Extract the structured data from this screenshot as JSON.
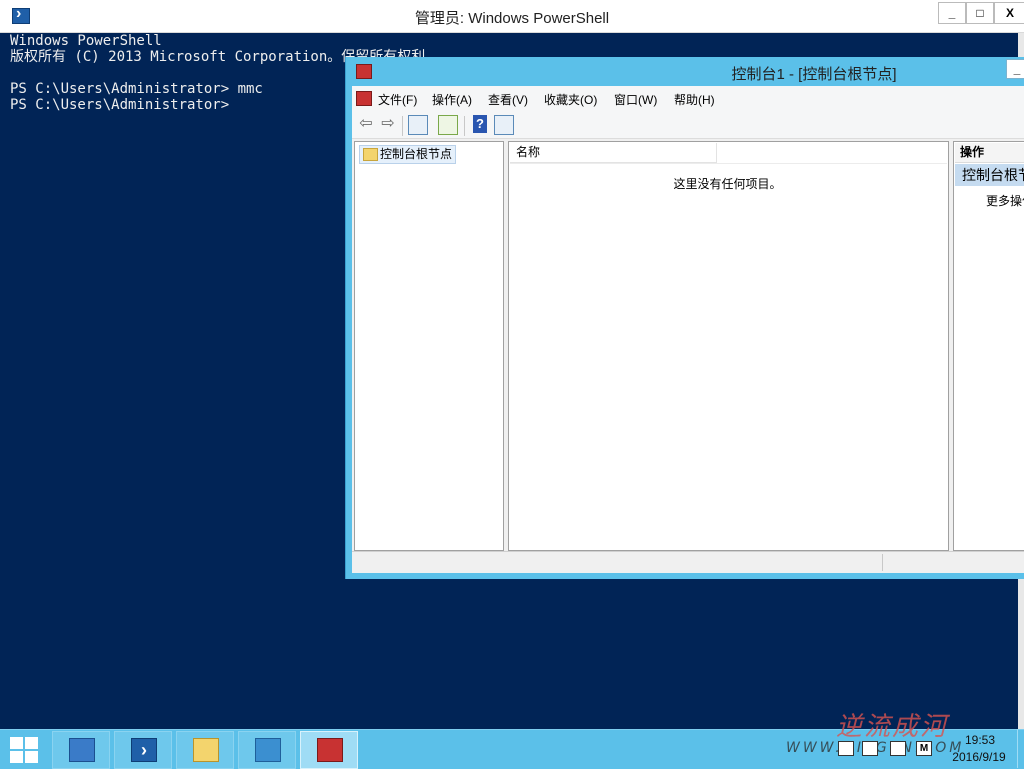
{
  "powershell": {
    "title": "管理员: Windows PowerShell",
    "lines": [
      "Windows PowerShell",
      "版权所有 (C) 2013 Microsoft Corporation。保留所有权利。",
      "",
      "PS C:\\Users\\Administrator> mmc",
      "PS C:\\Users\\Administrator>"
    ],
    "controls": {
      "minimize": "_",
      "maximize": "□",
      "close": "X"
    }
  },
  "mmc": {
    "title": "控制台1 - [控制台根节点]",
    "menu": [
      "文件(F)",
      "操作(A)",
      "查看(V)",
      "收藏夹(O)",
      "窗口(W)",
      "帮助(H)"
    ],
    "toolbar": [
      "back-icon",
      "forward-icon",
      "show-hide-tree-icon",
      "export-list-icon",
      "help-icon",
      "show-hide-action-pane-icon"
    ],
    "tree_root": "控制台根节点",
    "list_header": "名称",
    "empty_message": "这里没有任何项目。",
    "actions": {
      "header": "操作",
      "node": "控制台根节点",
      "more": "更多操作"
    }
  },
  "taskbar": {
    "items": [
      "server-manager-icon",
      "powershell-icon",
      "file-explorer-icon",
      "control-panel-icon",
      "mmc-icon"
    ],
    "time": "19:53",
    "date": "2016/9/19",
    "watermark_title": "逆流成河",
    "watermark_url": "WWW.QIEGEN.COM"
  },
  "colors": {
    "ps_background": "#012456",
    "window_accent": "#5bc0e9",
    "taskbar": "#5bc0e9"
  }
}
